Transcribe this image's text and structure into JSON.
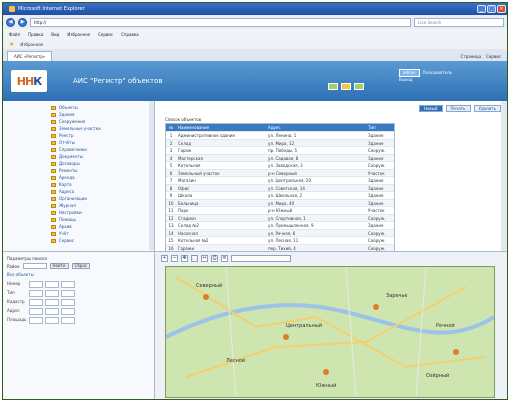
{
  "window": {
    "title": "Microsoft Internet Explorer",
    "minimize": "_",
    "maximize": "□",
    "close": "×"
  },
  "addressbar": {
    "back": "◀",
    "forward": "▶",
    "url": "http://",
    "search_placeholder": "Live Search"
  },
  "menubar": {
    "items": [
      "Файл",
      "Правка",
      "Вид",
      "Избранное",
      "Сервис",
      "Справка"
    ]
  },
  "favbar": {
    "label": "Избранное"
  },
  "tabbar": {
    "tab_label": "АИС «Регистр»",
    "commands": [
      "Страница",
      "Сервис"
    ]
  },
  "app": {
    "logo_left": "НН",
    "logo_right": "К",
    "title": "АИС \"Регистр\" объектов",
    "user_badge": "admin",
    "user_line1": "Пользователь",
    "user_line2": "Выход"
  },
  "tree": {
    "items": [
      "Объекты",
      "Здания",
      "Сооружения",
      "Земельные участки",
      "Реестр",
      "Отчёты",
      "Справочники",
      "Документы",
      "Договоры",
      "Ремонты",
      "Аренда",
      "Карта",
      "Адреса",
      "Организации",
      "Журнал",
      "Настройки",
      "Помощь",
      "Архив",
      "Учёт",
      "Сервис"
    ]
  },
  "form": {
    "title": "Параметры поиска",
    "row_label": "Район",
    "button1": "Найти",
    "button2": "Сброс",
    "link": "Все объекты",
    "labels": [
      "Номер",
      "Тип",
      "Кадастр",
      "Адрес",
      "Площадь"
    ]
  },
  "main": {
    "action_primary": "Новый",
    "action_secondary": "Печать",
    "action_tertiary": "Удалить",
    "grid_title": "Список объектов",
    "columns": [
      "№",
      "Наименование",
      "Адрес",
      "Тип"
    ],
    "rows": [
      [
        "1",
        "Административное здание",
        "ул. Ленина, 1",
        "Здание"
      ],
      [
        "2",
        "Склад",
        "ул. Мира, 12",
        "Здание"
      ],
      [
        "3",
        "Гараж",
        "пр. Победы, 5",
        "Сооруж."
      ],
      [
        "4",
        "Мастерская",
        "ул. Садовая, 8",
        "Здание"
      ],
      [
        "5",
        "Котельная",
        "ул. Заводская, 3",
        "Сооруж."
      ],
      [
        "6",
        "Земельный участок",
        "р-н Северный",
        "Участок"
      ],
      [
        "7",
        "Магазин",
        "ул. Центральная, 20",
        "Здание"
      ],
      [
        "8",
        "Офис",
        "ул. Советская, 14",
        "Здание"
      ],
      [
        "9",
        "Школа",
        "ул. Школьная, 2",
        "Здание"
      ],
      [
        "10",
        "Больница",
        "ул. Мира, 40",
        "Здание"
      ],
      [
        "11",
        "Парк",
        "р-н Южный",
        "Участок"
      ],
      [
        "12",
        "Стадион",
        "ул. Спортивная, 1",
        "Сооруж."
      ],
      [
        "13",
        "Склад №2",
        "ул. Промышленная, 9",
        "Здание"
      ],
      [
        "14",
        "Насосная",
        "ул. Речная, 6",
        "Сооруж."
      ],
      [
        "15",
        "Котельная №2",
        "ул. Лесная, 11",
        "Сооруж."
      ],
      [
        "16",
        "Гаражи",
        "пер. Тихий, 4",
        "Сооруж."
      ]
    ]
  },
  "map": {
    "toolbar_icons": [
      "zoom-in-icon",
      "zoom-out-icon",
      "pan-icon",
      "select-icon",
      "measure-icon",
      "print-icon",
      "layers-icon"
    ],
    "toolbar_glyphs": [
      "+",
      "−",
      "✥",
      "⬚",
      "↔",
      "⎙",
      "≡"
    ],
    "labels": [
      "Северный",
      "Центральный",
      "Южный",
      "Заречье",
      "Лесной",
      "Озёрный",
      "Речной"
    ]
  },
  "colors": {
    "header_top": "#5a9bd3",
    "header_bottom": "#2e6fb5",
    "map_land": "#cfe5b0",
    "map_road": "#f0d070",
    "grid_header": "#3c79c3"
  }
}
